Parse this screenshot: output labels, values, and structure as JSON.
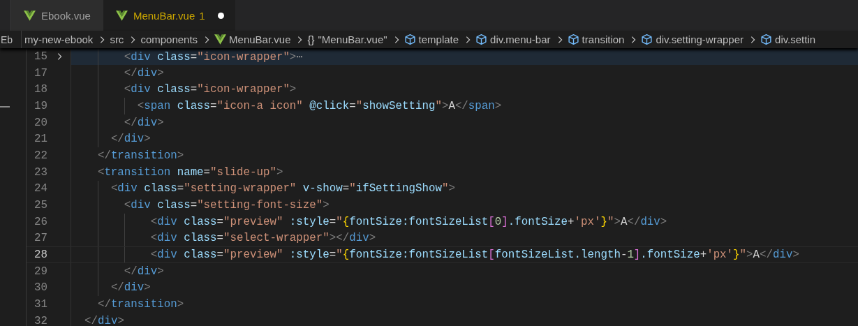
{
  "sidebar_fragment": {
    "text": "Eb"
  },
  "tabs": [
    {
      "label": "Ebook.vue",
      "selected": false,
      "modified": false
    },
    {
      "label": "MenuBar.vue",
      "problems": "1",
      "selected": true,
      "modified": true
    }
  ],
  "breadcrumbs": [
    {
      "kind": "folder",
      "label": "my-new-ebook"
    },
    {
      "kind": "folder",
      "label": "src"
    },
    {
      "kind": "folder",
      "label": "components"
    },
    {
      "kind": "vue",
      "label": "MenuBar.vue"
    },
    {
      "kind": "glyph",
      "glyph": "{}",
      "label": "\"MenuBar.vue\""
    },
    {
      "kind": "element",
      "label": "template"
    },
    {
      "kind": "element",
      "label": "div.menu-bar"
    },
    {
      "kind": "element",
      "label": "transition"
    },
    {
      "kind": "element",
      "label": "div.setting-wrapper"
    },
    {
      "kind": "element",
      "label": "div.settin"
    }
  ],
  "editor": {
    "lines": [
      {
        "number": "15",
        "folded": true,
        "current": false,
        "tokens": [
          {
            "kind": "punct",
            "text": "        <"
          },
          {
            "kind": "tag",
            "text": "div"
          },
          {
            "kind": "attr",
            "text": " class"
          },
          {
            "kind": "plain",
            "text": "="
          },
          {
            "kind": "string",
            "text": "\"icon-wrapper\""
          },
          {
            "kind": "punct",
            "text": ">"
          },
          {
            "kind": "fold",
            "text": "⋯"
          }
        ]
      },
      {
        "number": "17",
        "current": false,
        "tokens": [
          {
            "kind": "punct",
            "text": "        </"
          },
          {
            "kind": "tag",
            "text": "div"
          },
          {
            "kind": "punct",
            "text": ">"
          }
        ]
      },
      {
        "number": "18",
        "current": false,
        "tokens": [
          {
            "kind": "punct",
            "text": "        <"
          },
          {
            "kind": "tag",
            "text": "div"
          },
          {
            "kind": "attr",
            "text": " class"
          },
          {
            "kind": "plain",
            "text": "="
          },
          {
            "kind": "string",
            "text": "\"icon-wrapper\""
          },
          {
            "kind": "punct",
            "text": ">"
          }
        ]
      },
      {
        "number": "19",
        "current": false,
        "tokens": [
          {
            "kind": "punct",
            "text": "          <"
          },
          {
            "kind": "tag",
            "text": "span"
          },
          {
            "kind": "attr",
            "text": " class"
          },
          {
            "kind": "plain",
            "text": "="
          },
          {
            "kind": "string",
            "text": "\"icon-a icon\""
          },
          {
            "kind": "attr",
            "text": " @click"
          },
          {
            "kind": "plain",
            "text": "="
          },
          {
            "kind": "string",
            "text": "\""
          },
          {
            "kind": "var",
            "text": "showSetting"
          },
          {
            "kind": "string",
            "text": "\""
          },
          {
            "kind": "punct",
            "text": ">"
          },
          {
            "kind": "plain",
            "text": "A"
          },
          {
            "kind": "punct",
            "text": "</"
          },
          {
            "kind": "tag",
            "text": "span"
          },
          {
            "kind": "punct",
            "text": ">"
          }
        ]
      },
      {
        "number": "20",
        "current": false,
        "tokens": [
          {
            "kind": "punct",
            "text": "        </"
          },
          {
            "kind": "tag",
            "text": "div"
          },
          {
            "kind": "punct",
            "text": ">"
          }
        ]
      },
      {
        "number": "21",
        "current": false,
        "tokens": [
          {
            "kind": "punct",
            "text": "      </"
          },
          {
            "kind": "tag",
            "text": "div"
          },
          {
            "kind": "punct",
            "text": ">"
          }
        ]
      },
      {
        "number": "22",
        "current": false,
        "tokens": [
          {
            "kind": "punct",
            "text": "    </"
          },
          {
            "kind": "tag",
            "text": "transition"
          },
          {
            "kind": "punct",
            "text": ">"
          }
        ]
      },
      {
        "number": "23",
        "current": false,
        "tokens": [
          {
            "kind": "punct",
            "text": "    <"
          },
          {
            "kind": "tag",
            "text": "transition"
          },
          {
            "kind": "attr",
            "text": " name"
          },
          {
            "kind": "plain",
            "text": "="
          },
          {
            "kind": "string",
            "text": "\"slide-up\""
          },
          {
            "kind": "punct",
            "text": ">"
          }
        ]
      },
      {
        "number": "24",
        "current": false,
        "tokens": [
          {
            "kind": "punct",
            "text": "      <"
          },
          {
            "kind": "tag",
            "text": "div"
          },
          {
            "kind": "attr",
            "text": " class"
          },
          {
            "kind": "plain",
            "text": "="
          },
          {
            "kind": "string",
            "text": "\"setting-wrapper\""
          },
          {
            "kind": "attr",
            "text": " v-show"
          },
          {
            "kind": "plain",
            "text": "="
          },
          {
            "kind": "string",
            "text": "\""
          },
          {
            "kind": "var",
            "text": "ifSettingShow"
          },
          {
            "kind": "string",
            "text": "\""
          },
          {
            "kind": "punct",
            "text": ">"
          }
        ]
      },
      {
        "number": "25",
        "current": false,
        "tokens": [
          {
            "kind": "punct",
            "text": "        <"
          },
          {
            "kind": "tag",
            "text": "div"
          },
          {
            "kind": "attr",
            "text": " class"
          },
          {
            "kind": "plain",
            "text": "="
          },
          {
            "kind": "string",
            "text": "\"setting-font-size\""
          },
          {
            "kind": "punct",
            "text": ">"
          }
        ]
      },
      {
        "number": "26",
        "current": false,
        "tokens": [
          {
            "kind": "punct",
            "text": "            <"
          },
          {
            "kind": "tag",
            "text": "div"
          },
          {
            "kind": "attr",
            "text": " class"
          },
          {
            "kind": "plain",
            "text": "="
          },
          {
            "kind": "string",
            "text": "\"preview\""
          },
          {
            "kind": "attr",
            "text": " :style"
          },
          {
            "kind": "plain",
            "text": "="
          },
          {
            "kind": "string",
            "text": "\""
          },
          {
            "kind": "brace",
            "text": "{"
          },
          {
            "kind": "var",
            "text": "fontSize:fontSizeList"
          },
          {
            "kind": "bracket",
            "text": "["
          },
          {
            "kind": "number",
            "text": "0"
          },
          {
            "kind": "bracket",
            "text": "]"
          },
          {
            "kind": "var",
            "text": ".fontSize"
          },
          {
            "kind": "plain",
            "text": "+"
          },
          {
            "kind": "string",
            "text": "'px'"
          },
          {
            "kind": "brace",
            "text": "}"
          },
          {
            "kind": "string",
            "text": "\""
          },
          {
            "kind": "punct",
            "text": ">"
          },
          {
            "kind": "plain",
            "text": "A"
          },
          {
            "kind": "punct",
            "text": "</"
          },
          {
            "kind": "tag",
            "text": "div"
          },
          {
            "kind": "punct",
            "text": ">"
          }
        ]
      },
      {
        "number": "27",
        "current": false,
        "tokens": [
          {
            "kind": "punct",
            "text": "            <"
          },
          {
            "kind": "tag",
            "text": "div"
          },
          {
            "kind": "attr",
            "text": " class"
          },
          {
            "kind": "plain",
            "text": "="
          },
          {
            "kind": "string",
            "text": "\"select-wrapper\""
          },
          {
            "kind": "punct",
            "text": "></"
          },
          {
            "kind": "tag",
            "text": "div"
          },
          {
            "kind": "punct",
            "text": ">"
          }
        ]
      },
      {
        "number": "28",
        "current": true,
        "tokens": [
          {
            "kind": "punct",
            "text": "            <"
          },
          {
            "kind": "tag",
            "text": "div"
          },
          {
            "kind": "attr",
            "text": " class"
          },
          {
            "kind": "plain",
            "text": "="
          },
          {
            "kind": "string",
            "text": "\"preview\""
          },
          {
            "kind": "attr",
            "text": " :style"
          },
          {
            "kind": "plain",
            "text": "="
          },
          {
            "kind": "string",
            "text": "\""
          },
          {
            "kind": "brace",
            "text": "{"
          },
          {
            "kind": "var",
            "text": "fontSize:fontSizeList"
          },
          {
            "kind": "bracket",
            "text": "["
          },
          {
            "kind": "var",
            "text": "fontSizeList.length"
          },
          {
            "kind": "plain",
            "text": "-"
          },
          {
            "kind": "number",
            "text": "1"
          },
          {
            "kind": "bracket",
            "text": "]"
          },
          {
            "kind": "var",
            "text": ".fontSize"
          },
          {
            "kind": "plain",
            "text": "+"
          },
          {
            "kind": "string",
            "text": "'px'"
          },
          {
            "kind": "brace",
            "text": "}"
          },
          {
            "kind": "string",
            "text": "\""
          },
          {
            "kind": "punct",
            "text": ">"
          },
          {
            "kind": "plain",
            "text": "A"
          },
          {
            "kind": "punct",
            "text": "</"
          },
          {
            "kind": "tag",
            "text": "div"
          },
          {
            "kind": "punct",
            "text": ">"
          }
        ]
      },
      {
        "number": "29",
        "current": false,
        "tokens": [
          {
            "kind": "punct",
            "text": "        </"
          },
          {
            "kind": "tag",
            "text": "div"
          },
          {
            "kind": "punct",
            "text": ">"
          }
        ]
      },
      {
        "number": "30",
        "current": false,
        "tokens": [
          {
            "kind": "punct",
            "text": "      </"
          },
          {
            "kind": "tag",
            "text": "div"
          },
          {
            "kind": "punct",
            "text": ">"
          }
        ]
      },
      {
        "number": "31",
        "current": false,
        "tokens": [
          {
            "kind": "punct",
            "text": "    </"
          },
          {
            "kind": "tag",
            "text": "transition"
          },
          {
            "kind": "punct",
            "text": ">"
          }
        ]
      },
      {
        "number": "32",
        "current": false,
        "tokens": [
          {
            "kind": "punct",
            "text": "  </"
          },
          {
            "kind": "tag",
            "text": "div"
          },
          {
            "kind": "punct",
            "text": ">"
          }
        ]
      }
    ]
  }
}
